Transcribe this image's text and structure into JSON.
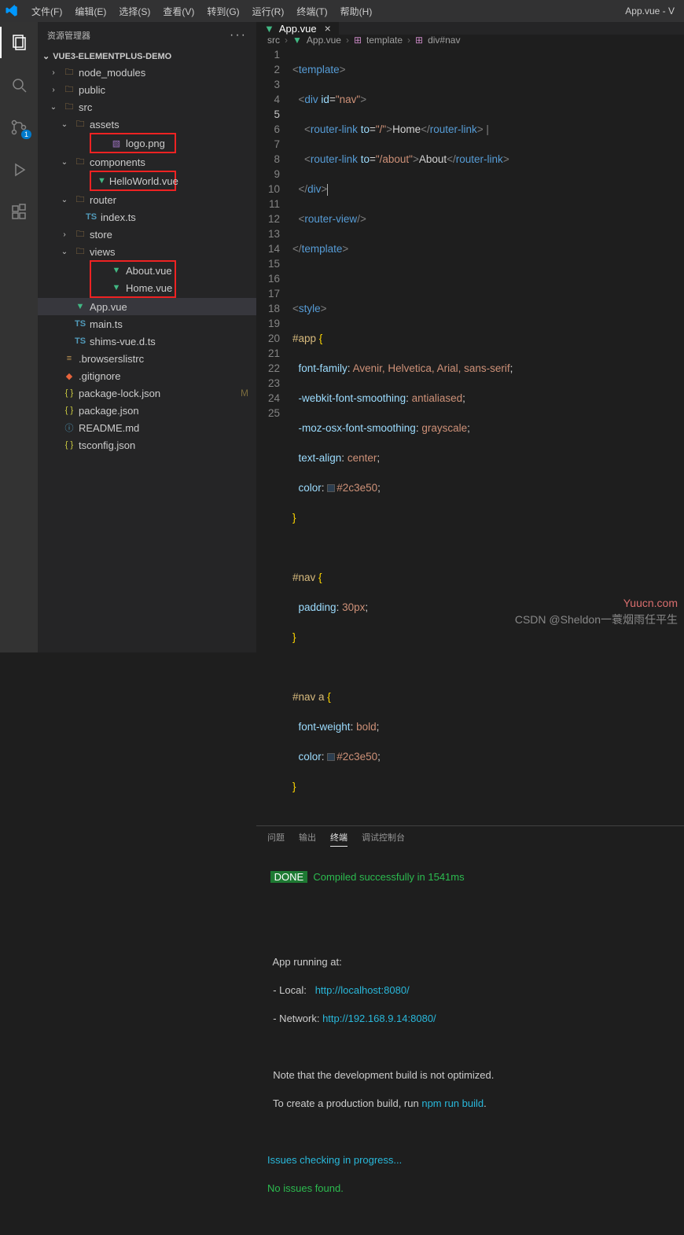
{
  "menu": {
    "items": [
      "文件(F)",
      "编辑(E)",
      "选择(S)",
      "查看(V)",
      "转到(G)",
      "运行(R)",
      "终端(T)",
      "帮助(H)"
    ],
    "title": "App.vue - V"
  },
  "sidebar": {
    "title": "资源管理器",
    "project": "VUE3-ELEMENTPLUS-DEMO"
  },
  "tree": [
    {
      "ind": 1,
      "tw": "›",
      "ic": "folder",
      "lbl": "node_modules"
    },
    {
      "ind": 1,
      "tw": "›",
      "ic": "folder",
      "lbl": "public"
    },
    {
      "ind": 1,
      "tw": "⌄",
      "ic": "folder",
      "lbl": "src"
    },
    {
      "ind": 2,
      "tw": "⌄",
      "ic": "folder",
      "lbl": "assets"
    },
    {
      "ind": 3,
      "tw": "",
      "ic": "img",
      "lbl": "logo.png",
      "box": 1
    },
    {
      "ind": 2,
      "tw": "⌄",
      "ic": "folder",
      "lbl": "components"
    },
    {
      "ind": 3,
      "tw": "",
      "ic": "vue",
      "lbl": "HelloWorld.vue",
      "box": 1
    },
    {
      "ind": 2,
      "tw": "⌄",
      "ic": "folder",
      "lbl": "router"
    },
    {
      "ind": 3,
      "tw": "",
      "ic": "ts",
      "lbl": "index.ts"
    },
    {
      "ind": 2,
      "tw": "›",
      "ic": "folder",
      "lbl": "store"
    },
    {
      "ind": 2,
      "tw": "⌄",
      "ic": "folder",
      "lbl": "views"
    },
    {
      "ind": 3,
      "tw": "",
      "ic": "vue",
      "lbl": "About.vue",
      "box": 2
    },
    {
      "ind": 3,
      "tw": "",
      "ic": "vue",
      "lbl": "Home.vue",
      "box": 2
    },
    {
      "ind": 2,
      "tw": "",
      "ic": "vue",
      "lbl": "App.vue",
      "hl": 1
    },
    {
      "ind": 2,
      "tw": "",
      "ic": "ts",
      "lbl": "main.ts"
    },
    {
      "ind": 2,
      "tw": "",
      "ic": "ts",
      "lbl": "shims-vue.d.ts"
    },
    {
      "ind": 1,
      "tw": "",
      "ic": "conf",
      "lbl": ".browserslistrc"
    },
    {
      "ind": 1,
      "tw": "",
      "ic": "git",
      "lbl": ".gitignore"
    },
    {
      "ind": 1,
      "tw": "",
      "ic": "json",
      "lbl": "package-lock.json",
      "tail": "M"
    },
    {
      "ind": 1,
      "tw": "",
      "ic": "json",
      "lbl": "package.json"
    },
    {
      "ind": 1,
      "tw": "",
      "ic": "info",
      "lbl": "README.md"
    },
    {
      "ind": 1,
      "tw": "",
      "ic": "json",
      "lbl": "tsconfig.json"
    }
  ],
  "tab": {
    "name": "App.vue"
  },
  "breadcrumb": {
    "p1": "src",
    "p2": "App.vue",
    "p3": "template",
    "p4": "div#nav"
  },
  "scm_badge": "1",
  "code": {
    "l1": {
      "a": "<",
      "b": "template",
      "c": ">"
    },
    "l2": {
      "a": "<",
      "b": "div ",
      "c": "id",
      "d": "=",
      "e": "\"nav\"",
      "f": ">"
    },
    "l3": {
      "a": "<",
      "b": "router-link ",
      "c": "to",
      "d": "=",
      "e": "\"/\"",
      "f": ">",
      "g": "Home",
      "h": "</",
      "i": "router-link",
      "j": "> |"
    },
    "l4": {
      "a": "<",
      "b": "router-link ",
      "c": "to",
      "d": "=",
      "e": "\"/about\"",
      "f": ">",
      "g": "About",
      "h": "</",
      "i": "router-link",
      "j": ">"
    },
    "l5": {
      "a": "</",
      "b": "div",
      "c": ">"
    },
    "l6": {
      "a": "<",
      "b": "router-view",
      "c": "/>"
    },
    "l7": {
      "a": "</",
      "b": "template",
      "c": ">"
    },
    "l9": {
      "a": "<",
      "b": "style",
      "c": ">"
    },
    "l10": {
      "a": "#app ",
      "b": "{"
    },
    "l11": {
      "a": "font-family",
      "b": ": ",
      "c": "Avenir, Helvetica, Arial, sans-serif",
      "d": ";"
    },
    "l12": {
      "a": "-webkit-font-smoothing",
      "b": ": ",
      "c": "antialiased",
      "d": ";"
    },
    "l13": {
      "a": "-moz-osx-font-smoothing",
      "b": ": ",
      "c": "grayscale",
      "d": ";"
    },
    "l14": {
      "a": "text-align",
      "b": ": ",
      "c": "center",
      "d": ";"
    },
    "l15": {
      "a": "color",
      "b": ": ",
      "c": "#2c3e50",
      "d": ";"
    },
    "l16": {
      "a": "}"
    },
    "l18": {
      "a": "#nav ",
      "b": "{"
    },
    "l19": {
      "a": "padding",
      "b": ": ",
      "c": "30px",
      "d": ";"
    },
    "l20": {
      "a": "}"
    },
    "l22": {
      "a": "#nav a ",
      "b": "{"
    },
    "l23": {
      "a": "font-weight",
      "b": ": ",
      "c": "bold",
      "d": ";"
    },
    "l24": {
      "a": "color",
      "b": ": ",
      "c": "#2c3e50",
      "d": ";"
    },
    "l25": {
      "a": "}"
    }
  },
  "panel": {
    "tabs": [
      "问题",
      "输出",
      "终端",
      "调试控制台"
    ],
    "active": 2
  },
  "term": {
    "done": "DONE",
    "done_msg": "Compiled successfully in 1541ms",
    "l1": "App running at:",
    "l2a": "- Local:   ",
    "l2b": "http://localhost:",
    "l2c": "8080",
    "l2d": "/",
    "l3a": "- Network: ",
    "l3b": "http://192.168.9.14:",
    "l3c": "8080",
    "l3d": "/",
    "l4": "Note that the development build is not optimized.",
    "l5a": "To create a production build, run ",
    "l5b": "npm run build",
    "l5c": ".",
    "l6": "Issues checking in progress...",
    "l7": "No issues found."
  },
  "watermark": {
    "a": "Yuucn.com",
    "b": "CSDN @Sheldon一蓑烟雨任平生"
  }
}
